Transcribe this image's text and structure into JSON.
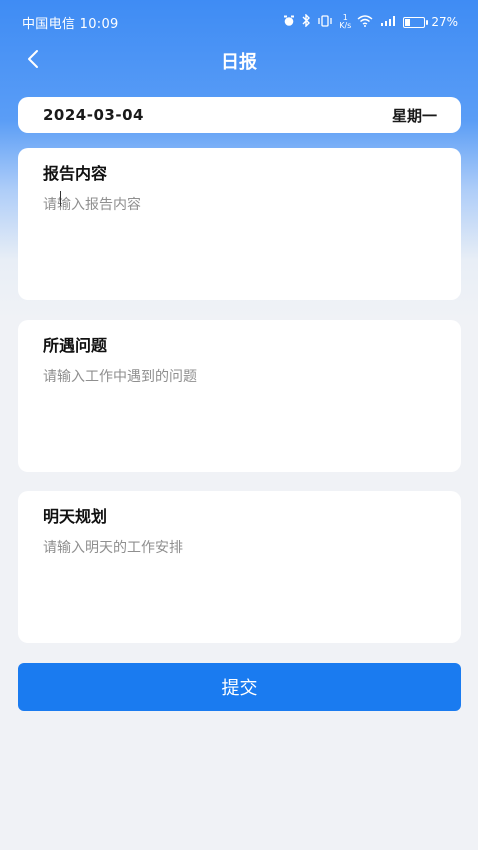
{
  "status_bar": {
    "carrier_time": "中国电信 10:09",
    "battery_percent": "27%",
    "battery_level": 0.27,
    "icons": [
      "alarm-icon",
      "bluetooth-icon",
      "vibrate-icon",
      "network-speed-icon",
      "wifi-icon",
      "signal-icon",
      "battery-icon"
    ],
    "speed_top": "1",
    "speed_unit": "K/s"
  },
  "nav": {
    "back_icon": "chevron-left-icon",
    "title": "日报"
  },
  "date_card": {
    "date": "2024-03-04",
    "weekday": "星期一"
  },
  "sections": [
    {
      "title": "报告内容",
      "placeholder": "请输入报告内容",
      "value": ""
    },
    {
      "title": "所遇问题",
      "placeholder": "请输入工作中遇到的问题",
      "value": ""
    },
    {
      "title": "明天规划",
      "placeholder": "请输入明天的工作安排",
      "value": ""
    }
  ],
  "submit_label": "提交",
  "colors": {
    "accent": "#1a7bf0",
    "header_blue": "#3f8cf4",
    "background": "#f0f2f6",
    "card": "#ffffff",
    "placeholder": "#8f8f8f"
  }
}
